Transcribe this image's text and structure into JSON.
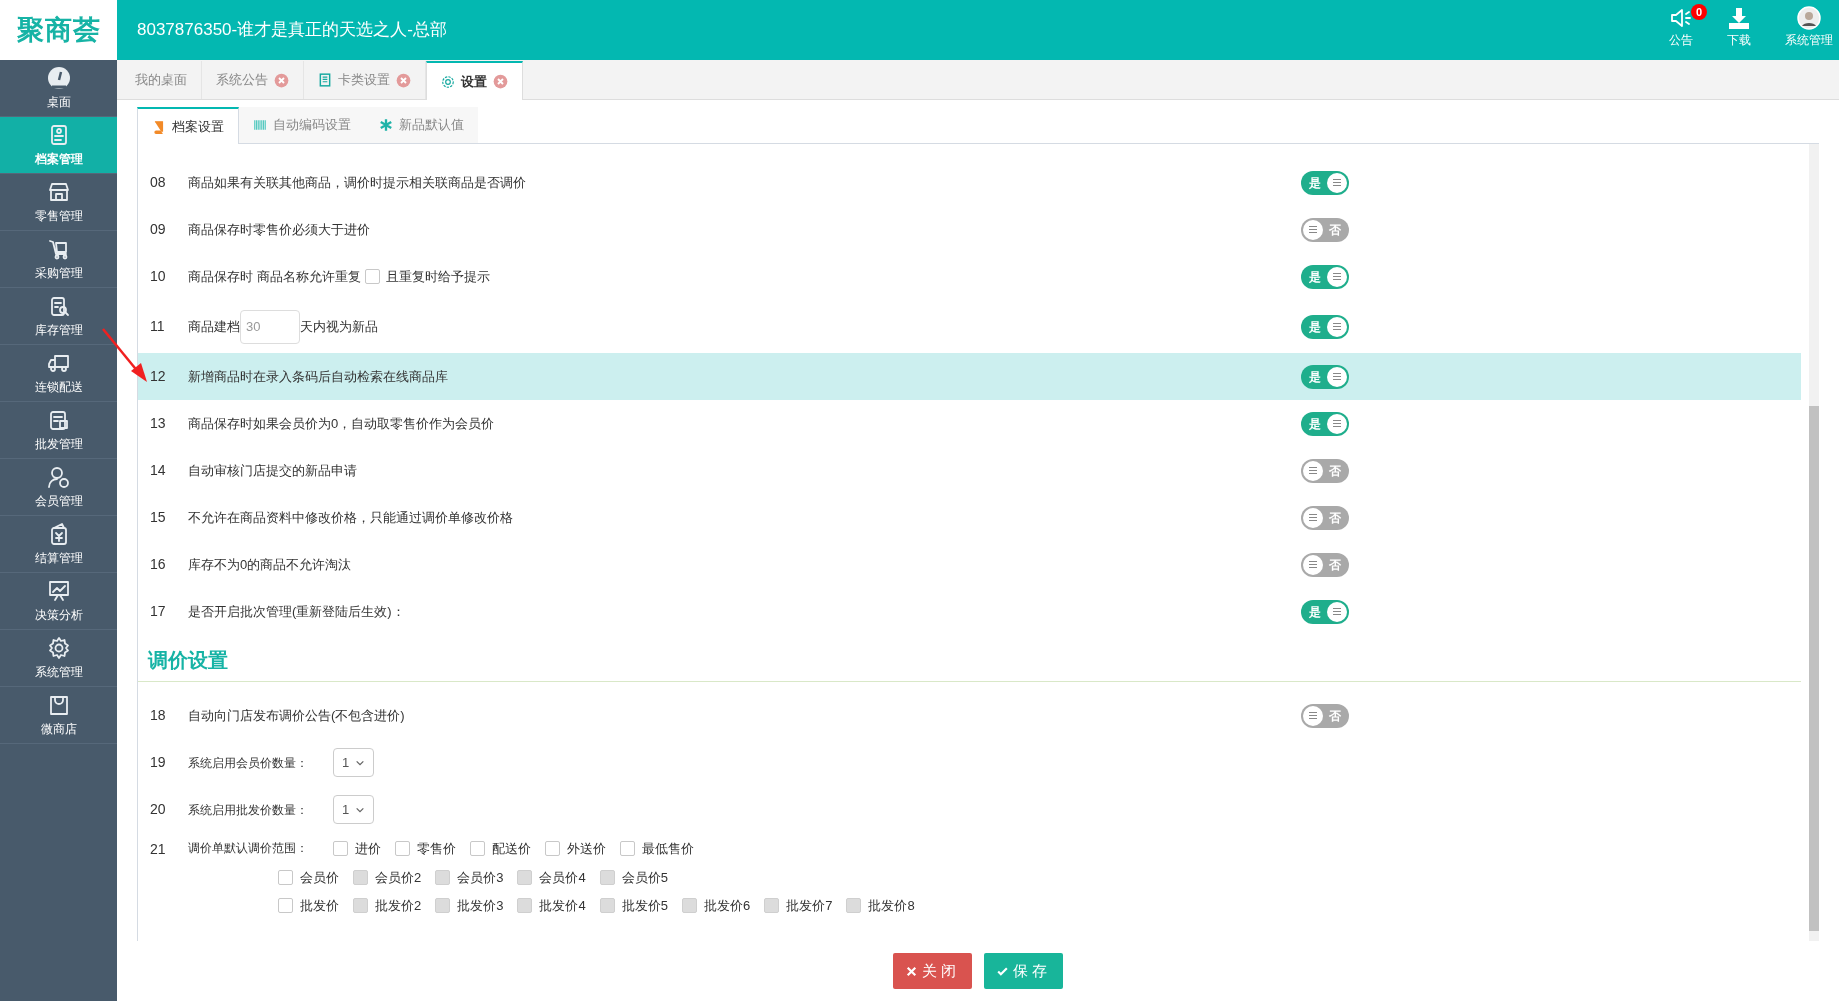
{
  "header": {
    "logo": "聚商荟",
    "title": "8037876350-谁才是真正的天选之人-总部",
    "actions": [
      {
        "kind": "notice",
        "label": "公告",
        "badge": "0"
      },
      {
        "kind": "download",
        "label": "下载"
      },
      {
        "kind": "user",
        "label": "系统管理"
      }
    ]
  },
  "sidebar": {
    "items": [
      {
        "label": "桌面",
        "selected": false
      },
      {
        "label": "档案管理",
        "selected": true
      },
      {
        "label": "零售管理",
        "selected": false
      },
      {
        "label": "采购管理",
        "selected": false
      },
      {
        "label": "库存管理",
        "selected": false
      },
      {
        "label": "连锁配送",
        "selected": false
      },
      {
        "label": "批发管理",
        "selected": false
      },
      {
        "label": "会员管理",
        "selected": false
      },
      {
        "label": "结算管理",
        "selected": false
      },
      {
        "label": "决策分析",
        "selected": false
      },
      {
        "label": "系统管理",
        "selected": false
      },
      {
        "label": "微商店",
        "selected": false
      }
    ]
  },
  "tabs": [
    {
      "label": "我的桌面",
      "selected": false,
      "closable": false
    },
    {
      "label": "系统公告",
      "selected": false,
      "closable": true
    },
    {
      "label": "卡类设置",
      "selected": false,
      "closable": true
    },
    {
      "label": "设置",
      "selected": true,
      "closable": true
    }
  ],
  "subtabs": [
    {
      "label": "档案设置",
      "selected": true
    },
    {
      "label": "自动编码设置",
      "selected": false
    },
    {
      "label": "新品默认值",
      "selected": false
    }
  ],
  "rows": [
    {
      "kind": "switch",
      "number": "08",
      "text": "商品如果有关联其他商品，调价时提示相关联商品是否调价",
      "on": true,
      "switch_text": "是",
      "selected": false
    },
    {
      "kind": "switch",
      "number": "09",
      "text": "商品保存时零售价必须大于进价",
      "on": false,
      "switch_text": "否",
      "selected": false
    },
    {
      "kind": "switch_checkbox",
      "number": "10",
      "text": "商品保存时 商品名称允许重复",
      "checked": false,
      "after": "且重复时给予提示",
      "on": true,
      "switch_text": "是",
      "selected": false
    },
    {
      "kind": "switch_input",
      "number": "11",
      "text": "商品建档",
      "value": "30",
      "after": "天内视为新品",
      "on": true,
      "switch_text": "是",
      "selected": false
    },
    {
      "kind": "switch",
      "number": "12",
      "text": "新增商品时在录入条码后自动检索在线商品库",
      "on": true,
      "switch_text": "是",
      "selected": true
    },
    {
      "kind": "switch",
      "number": "13",
      "text": "商品保存时如果会员价为0，自动取零售价作为会员价",
      "on": true,
      "switch_text": "是",
      "selected": false
    },
    {
      "kind": "switch",
      "number": "14",
      "text": "自动审核门店提交的新品申请",
      "on": false,
      "switch_text": "否",
      "selected": false
    },
    {
      "kind": "switch",
      "number": "15",
      "text": "不允许在商品资料中修改价格，只能通过调价单修改价格",
      "on": false,
      "switch_text": "否",
      "selected": false
    },
    {
      "kind": "switch",
      "number": "16",
      "text": "库存不为0的商品不允许淘汰",
      "on": false,
      "switch_text": "否",
      "selected": false
    },
    {
      "kind": "switch",
      "number": "17",
      "text": "是否开启批次管理(重新登陆后生效)：",
      "on": true,
      "switch_text": "是",
      "selected": false
    },
    {
      "kind": "heading",
      "text": "调价设置"
    },
    {
      "kind": "switch",
      "number": "18",
      "text": "自动向门店发布调价公告(不包含进价)",
      "on": false,
      "switch_text": "否",
      "selected": false
    },
    {
      "kind": "select",
      "number": "19",
      "text": "系统启用会员价数量：",
      "value": "1"
    },
    {
      "kind": "select",
      "number": "20",
      "text": "系统启用批发价数量：",
      "value": "1"
    },
    {
      "kind": "checkboxes",
      "number": "21",
      "text": "调价单默认调价范围：",
      "lines": [
        [
          {
            "label": "进价",
            "checked": false,
            "disabled": false
          },
          {
            "label": "零售价",
            "checked": false,
            "disabled": false
          },
          {
            "label": "配送价",
            "checked": false,
            "disabled": false
          },
          {
            "label": "外送价",
            "checked": false,
            "disabled": false
          },
          {
            "label": "最低售价",
            "checked": false,
            "disabled": false
          }
        ],
        [
          {
            "label": "会员价",
            "checked": false,
            "disabled": false
          },
          {
            "label": "会员价2",
            "checked": false,
            "disabled": true
          },
          {
            "label": "会员价3",
            "checked": false,
            "disabled": true
          },
          {
            "label": "会员价4",
            "checked": false,
            "disabled": true
          },
          {
            "label": "会员价5",
            "checked": false,
            "disabled": true
          }
        ],
        [
          {
            "label": "批发价",
            "checked": false,
            "disabled": false
          },
          {
            "label": "批发价2",
            "checked": false,
            "disabled": true
          },
          {
            "label": "批发价3",
            "checked": false,
            "disabled": true
          },
          {
            "label": "批发价4",
            "checked": false,
            "disabled": true
          },
          {
            "label": "批发价5",
            "checked": false,
            "disabled": true
          },
          {
            "label": "批发价6",
            "checked": false,
            "disabled": true
          },
          {
            "label": "批发价7",
            "checked": false,
            "disabled": true
          },
          {
            "label": "批发价8",
            "checked": false,
            "disabled": true
          }
        ]
      ]
    }
  ],
  "buttons": [
    {
      "kind": "close",
      "label": "关闭"
    },
    {
      "kind": "save",
      "label": "保存"
    }
  ]
}
